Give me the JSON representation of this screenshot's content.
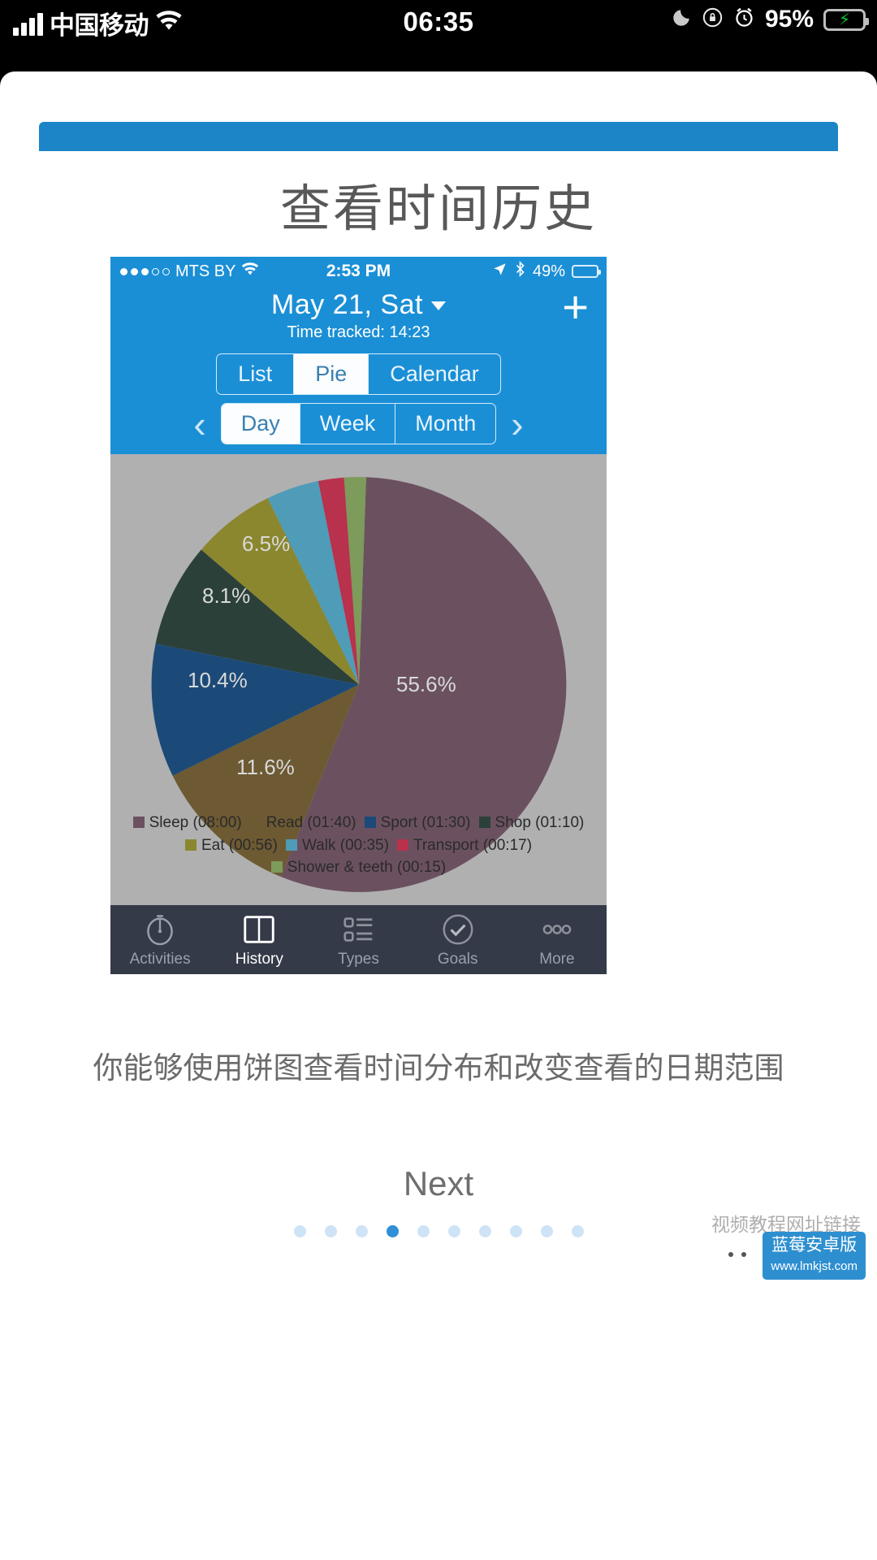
{
  "system_status_bar": {
    "carrier": "中国移动",
    "signal_icon": "signal-bars-icon",
    "wifi_icon": "wifi-icon",
    "time": "06:35",
    "moon_icon": "moon-icon",
    "rotation_lock_icon": "rotation-lock-icon",
    "alarm_icon": "alarm-icon",
    "battery_percent": "95%",
    "battery_icon": "battery-charging-icon"
  },
  "page": {
    "title": "查看时间历史",
    "caption": "你能够使用饼图查看时间分布和改变查看的日期范围",
    "next_label": "Next",
    "accent_color": "#1b8fd6",
    "pager": {
      "total": 10,
      "active_index": 3
    }
  },
  "screenshot": {
    "status_bar": {
      "signal_dots_filled": 3,
      "signal_dots_total": 5,
      "carrier": "MTS BY",
      "wifi_icon": "wifi-icon",
      "time": "2:53 PM",
      "location_icon": "location-arrow-icon",
      "bluetooth_icon": "bluetooth-icon",
      "battery_percent": "49%",
      "battery_icon": "battery-icon"
    },
    "header": {
      "date": "May 21, Sat",
      "date_caret_icon": "chevron-down-icon",
      "time_tracked": "Time tracked: 14:23",
      "add_label": "+"
    },
    "view_segments": {
      "options": [
        "List",
        "Pie",
        "Calendar"
      ],
      "selected": "Pie"
    },
    "range_segments": {
      "prev_icon": "chevron-left-icon",
      "next_icon": "chevron-right-icon",
      "options": [
        "Day",
        "Week",
        "Month"
      ],
      "selected": "Day"
    },
    "tabbar": {
      "items": [
        {
          "label": "Activities",
          "icon": "stopwatch-icon",
          "active": false
        },
        {
          "label": "History",
          "icon": "book-icon",
          "active": true
        },
        {
          "label": "Types",
          "icon": "list-icon",
          "active": false
        },
        {
          "label": "Goals",
          "icon": "check-circle-icon",
          "active": false
        },
        {
          "label": "More",
          "icon": "ellipsis-icon",
          "active": false
        }
      ]
    }
  },
  "chart_data": {
    "type": "pie",
    "title": "Time tracked: 14:23",
    "legend_position": "bottom",
    "background": "#b0b0b0",
    "labels": [
      "Sleep",
      "Read",
      "Sport",
      "Shop",
      "Eat",
      "Walk",
      "Transport",
      "Shower & teeth"
    ],
    "durations": [
      "08:00",
      "01:40",
      "01:30",
      "01:10",
      "00:56",
      "00:35",
      "00:17",
      "00:15"
    ],
    "legend_entries": [
      "Sleep (08:00)",
      "Read (01:40)",
      "Sport (01:30)",
      "Shop (01:10)",
      "Eat (00:56)",
      "Walk (00:35)",
      "Transport (00:17)",
      "Shower & teeth (00:15)"
    ],
    "values": [
      55.6,
      11.6,
      10.4,
      8.1,
      6.5,
      4.1,
      2.0,
      1.7
    ],
    "visible_value_labels": [
      "55.6%",
      "11.6%",
      "10.4%",
      "8.1%",
      "6.5%"
    ],
    "colors": [
      "#6b5160",
      "#6d5a33",
      "#1c4a78",
      "#2c403a",
      "#8b872f",
      "#4e9cb8",
      "#b8314d",
      "#7d9b5a"
    ]
  },
  "watermark": {
    "line1": "视频教程网址链接",
    "badge": "蓝莓安卓版",
    "url": "www.lmkjst.com"
  }
}
